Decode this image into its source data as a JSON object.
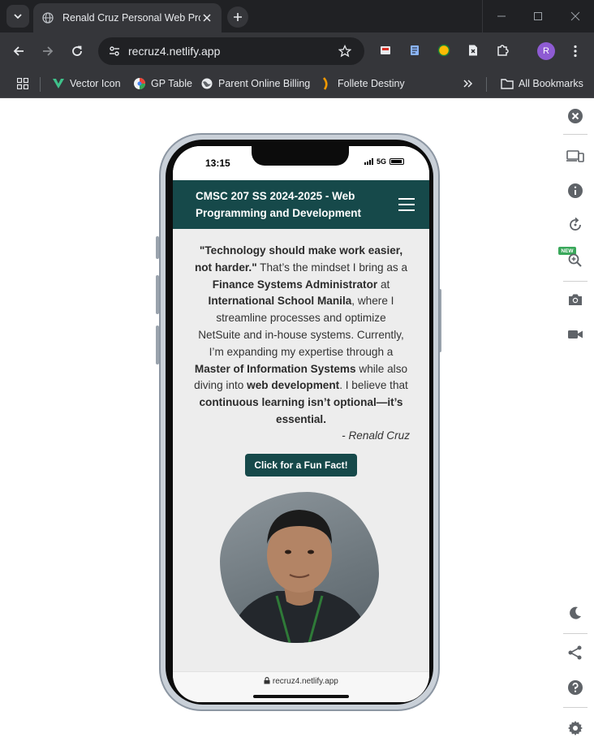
{
  "browser": {
    "tab_title": "Renald Cruz Personal Web Profi",
    "url": "recruz4.netlify.app",
    "profile_initial": "R",
    "bookmarks": [
      {
        "label": "Vector Icon",
        "icon": "vector-icon-favicon"
      },
      {
        "label": "GP Table",
        "icon": "gp-table-favicon"
      },
      {
        "label": "Parent Online Billing",
        "icon": "globe-icon"
      },
      {
        "label": "Follete Destiny",
        "icon": "follett-favicon"
      }
    ],
    "all_bookmarks_label": "All Bookmarks"
  },
  "phone": {
    "status_time": "13:15",
    "network": "5G",
    "safari_url": "recruz4.netlify.app"
  },
  "site": {
    "nav_title": "CMSC 207 SS 2024-2025 - Web Programming and Development",
    "quote_parts": {
      "p1": "\"Technology should make work easier, not harder.\"",
      "p2": " That’s the mindset I bring as a ",
      "p3": "Finance Systems Administrator",
      "p4": " at ",
      "p5": "International School Manila",
      "p6": ", where I streamline processes and optimize NetSuite and in-house systems. Currently, I’m expanding my expertise through a ",
      "p7": "Master of Information Systems",
      "p8": " while also diving into ",
      "p9": "web development",
      "p10": ". I believe that ",
      "p11": "continuous learning isn’t optional—it’s essential."
    },
    "attribution": "- Renald Cruz",
    "fun_fact_button": "Click for a Fun Fact!"
  },
  "colors": {
    "brand": "#16494a",
    "page_bg": "#ededed",
    "chrome_dark": "#202124",
    "chrome_toolbar": "#35363a"
  }
}
